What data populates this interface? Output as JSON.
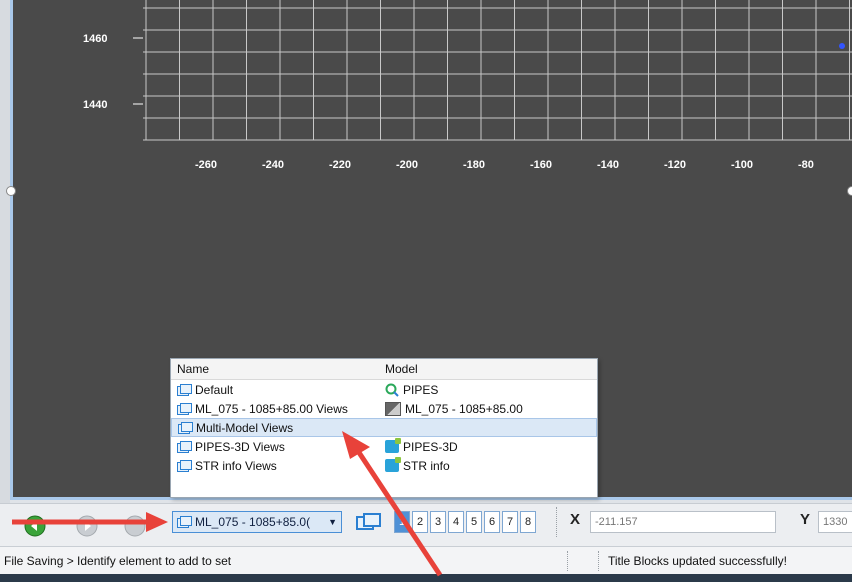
{
  "graph": {
    "y_ticks": [
      "1460",
      "1440"
    ],
    "x_ticks": [
      "-260",
      "-240",
      "-220",
      "-200",
      "-180",
      "-160",
      "-140",
      "-120",
      "-100",
      "-80"
    ]
  },
  "popup": {
    "headers": {
      "name": "Name",
      "model": "Model"
    },
    "rows": [
      {
        "name": "Default",
        "model": "PIPES",
        "name_icon": "view-icon",
        "model_icon": "pipes-icon"
      },
      {
        "name": "ML_075 - 1085+85.00 Views",
        "model": "ML_075 - 1085+85.00",
        "name_icon": "view-icon",
        "model_icon": "sheet-icon"
      },
      {
        "name": "Multi-Model Views",
        "model": "",
        "name_icon": "view-icon",
        "model_icon": "",
        "selected": true
      },
      {
        "name": "PIPES-3D Views",
        "model": "PIPES-3D",
        "name_icon": "view-icon",
        "model_icon": "3d-model-icon"
      },
      {
        "name": "STR info Views",
        "model": "STR info",
        "name_icon": "view-icon",
        "model_icon": "3d-model-icon"
      }
    ]
  },
  "toolbar": {
    "view_selector_value": "ML_075 - 1085+85.0(",
    "view_numbers": [
      "1",
      "2",
      "3",
      "4",
      "5",
      "6",
      "7",
      "8"
    ],
    "active_view": "1",
    "x_label": "X",
    "x_value": "-211.157",
    "y_label": "Y",
    "y_value": "1330"
  },
  "status": {
    "left": "File Saving > Identify element to add to set",
    "right": "Title Blocks updated successfully!"
  },
  "colors": {
    "canvas": "#4a4a4a",
    "accent": "#2a7fd1",
    "arrow": "#e8423a"
  }
}
